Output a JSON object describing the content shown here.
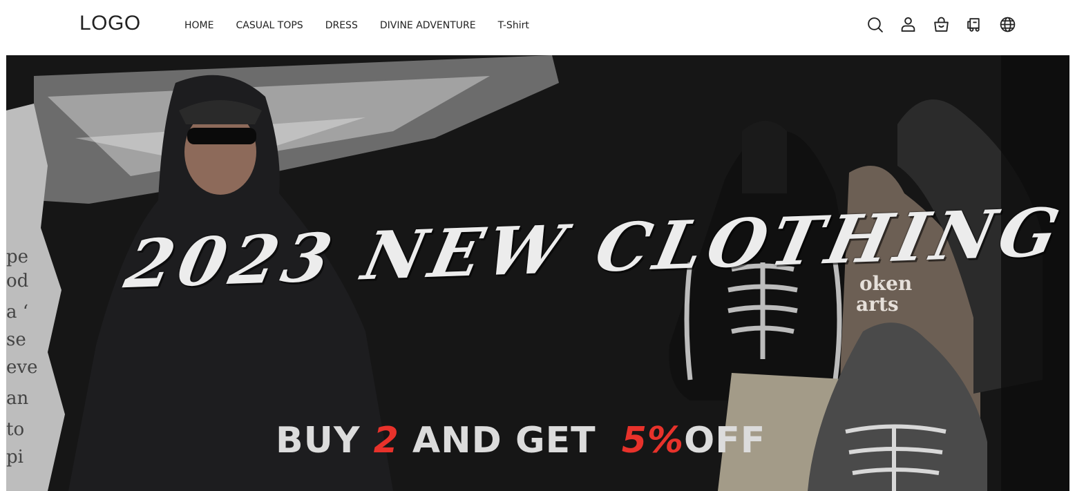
{
  "header": {
    "logo": "LOGO",
    "nav": [
      "HOME",
      "CASUAL TOPS",
      "DRESS",
      "DIVINE ADVENTURE",
      "T-Shirt"
    ],
    "icons": [
      "search-icon",
      "user-icon",
      "bag-icon",
      "delivery-truck-icon",
      "globe-icon"
    ]
  },
  "banner": {
    "headline": "2023 NEW CLOTHING",
    "promo": {
      "prefix": "BUY",
      "qty": "2",
      "middle": "AND GET",
      "discount": "5%",
      "suffix": "OFF"
    },
    "graphic_print": "oken arts"
  },
  "colors": {
    "accent_red": "#e8322b",
    "banner_bg": "#141414",
    "text_light": "#ececec"
  }
}
